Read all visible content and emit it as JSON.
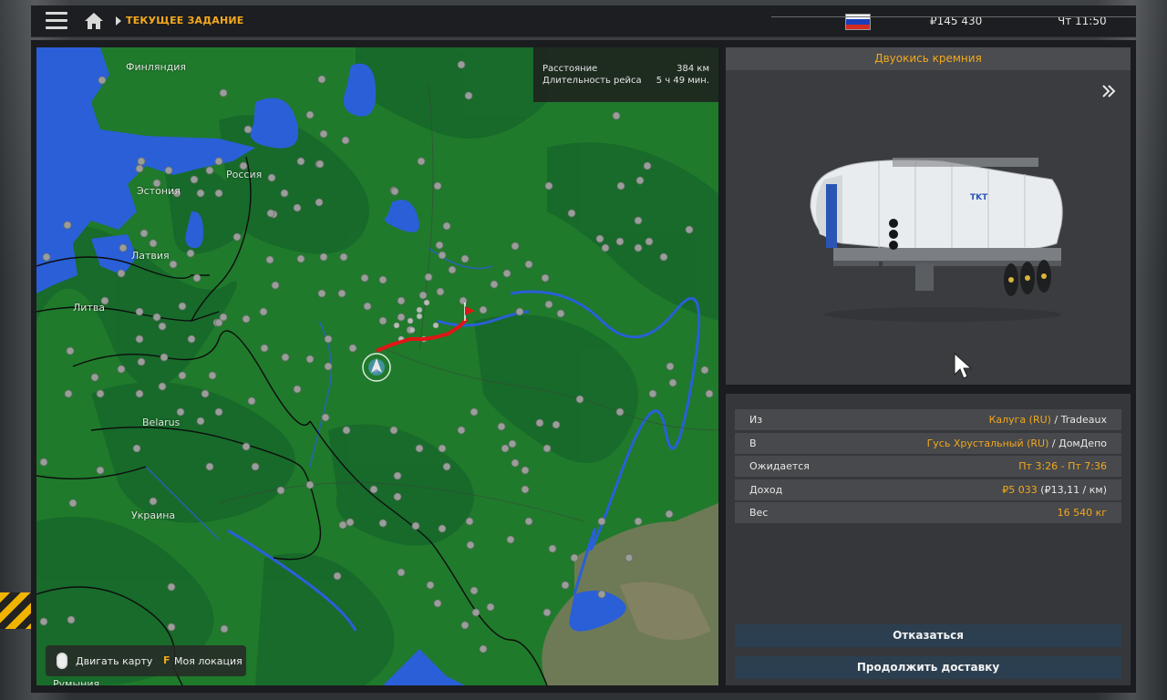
{
  "header": {
    "breadcrumb": "ТЕКУЩЕЕ ЗАДАНИЕ",
    "money": "₽145 430",
    "time": "Чт 11:50",
    "flag_colors": [
      "#ffffff",
      "#1c3fb8",
      "#d52b1e"
    ]
  },
  "map": {
    "labels": {
      "finland": "Финляндия",
      "russia": "Россия",
      "estonia": "Эстония",
      "latvia": "Латвия",
      "lithuania": "Литва",
      "belarus": "Belarus",
      "ukraine": "Украина",
      "romania": "Румыния"
    },
    "trip": {
      "distance_label": "Расстояние",
      "distance_value": "384 км",
      "duration_label": "Длительность рейса",
      "duration_value": "5 ч 49 мин."
    },
    "hints": {
      "move_label": "Двигать карту",
      "location_key": "F",
      "location_label": "Моя локация"
    },
    "colors": {
      "land": "#1f7a2b",
      "water": "#2a5fd8",
      "route": "#e01515",
      "steppe": "#6e7a55"
    }
  },
  "cargo": {
    "name": "Двуокись кремния"
  },
  "details": {
    "from_label": "Из",
    "from_city": "Калуга (RU)",
    "from_company": "Tradeaux",
    "to_label": "В",
    "to_city": "Гусь Хрустальный (RU)",
    "to_company": "ДомДепо",
    "expected_label": "Ожидается",
    "expected_value": "Пт 3:26 - Пт 7:36",
    "income_label": "Доход",
    "income_value": "₽5 033",
    "income_rate": "(₽13,11 / км)",
    "weight_label": "Вес",
    "weight_value": "16 540 кг"
  },
  "actions": {
    "cancel": "Отказаться",
    "continue": "Продолжить доставку"
  }
}
